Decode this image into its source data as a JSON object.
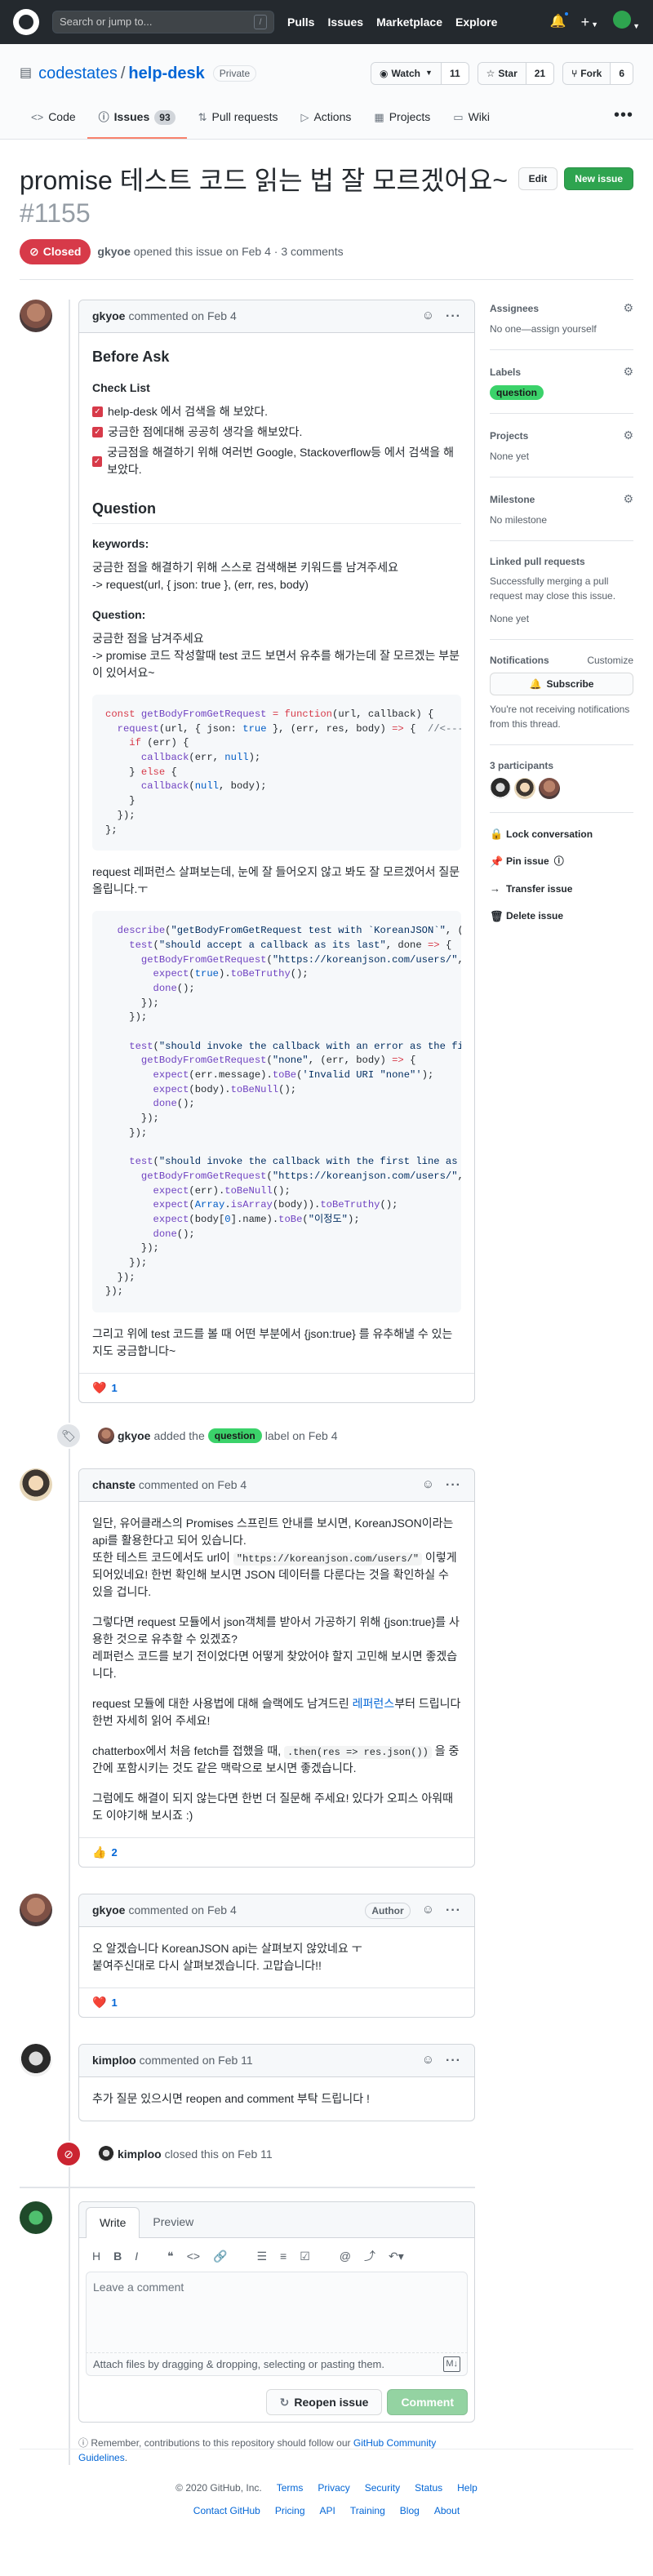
{
  "header": {
    "search_placeholder": "Search or jump to...",
    "search_key": "/",
    "nav": [
      "Pulls",
      "Issues",
      "Marketplace",
      "Explore"
    ]
  },
  "repo": {
    "owner": "codestates",
    "name": "help-desk",
    "visibility": "Private",
    "watch": {
      "label": "Watch",
      "count": "11"
    },
    "star": {
      "label": "Star",
      "count": "21"
    },
    "fork": {
      "label": "Fork",
      "count": "6"
    },
    "tabs": [
      {
        "label": "Code",
        "icon": "code-icon"
      },
      {
        "label": "Issues",
        "icon": "issue-icon",
        "count": "93"
      },
      {
        "label": "Pull requests",
        "icon": "pull-request-icon"
      },
      {
        "label": "Actions",
        "icon": "play-icon"
      },
      {
        "label": "Projects",
        "icon": "project-icon"
      },
      {
        "label": "Wiki",
        "icon": "book-icon"
      }
    ]
  },
  "issue": {
    "title": "promise 테스트 코드 읽는 법 잘 모르겠어요~",
    "number": "#1155",
    "state": "Closed",
    "author": "gkyoe",
    "opened_text": "opened this issue on Feb 4 · 3 comments",
    "edit_label": "Edit",
    "new_issue_label": "New issue"
  },
  "comments": [
    {
      "author": "gkyoe",
      "meta": "commented on Feb 4",
      "before_ask": "Before Ask",
      "checklist_title": "Check List",
      "checklist": [
        "help-desk 에서 검색을 해 보았다.",
        "궁금한 점에대해 공공히 생각을 해보았다.",
        "궁금점을 해결하기 위해 여러번 Google, Stackoverflow등 에서 검색을 해보았다."
      ],
      "question_heading": "Question",
      "keywords_label": "keywords:",
      "keywords_text1": "궁금한 점을 해결하기 위해 스스로 검색해본 키워드를 남겨주세요",
      "keywords_text2": "-> request(url, { json: true }, (err, res, body)",
      "question_label": "Question:",
      "question_text1": "궁금한 점을 남겨주세요",
      "question_text2": "-> promise 코드 작성할때 test 코드 보면서 유추를 해가는데 잘 모르겠는 부분이 있어서요~",
      "middle_text": "request 레퍼런스 살펴보는데, 눈에 잘 들어오지 않고 봐도 잘 모르겠어서 질문 올립니다.ㅜ",
      "closing_text": "그리고 위에 test 코드를 볼 때 어떤 부분에서 {json:true} 를 유추해낼 수 있는 지도 궁금합니다~",
      "reaction_emoji": "❤️",
      "reaction_count": "1"
    },
    {
      "author": "chanste",
      "meta": "commented on Feb 4",
      "p1": "일단, 유어클래스의 Promises 스프린트 안내를 보시면, KoreanJSON이라는 api를 활용한다고 되어 있습니다.",
      "p1b_pre": "또한 테스트 코드에서도 url이 ",
      "p1b_code": "\"https://koreanjson.com/users/\"",
      "p1b_post": " 이렇게 되어있네요! 한번 확인해 보시면 JSON 데이터를 다룬다는 것을 확인하실 수 있을 겁니다.",
      "p2": "그렇다면 request 모듈에서 json객체를 받아서 가공하기 위해 {json:true}를 사용한 것으로 유추할 수 있겠죠?",
      "p2b": "레퍼런스 코드를 보기 전이었다면 어떻게 찾았어야 할지 고민해 보시면 좋겠습니다.",
      "p3_pre": "request 모듈에 대한 사용법에 대해 슬랙에도 남겨드린 ",
      "p3_link": "레퍼런스",
      "p3_post": "부터 드립니다 한번 자세히 읽어 주세요!",
      "p4_pre": "chatterbox에서 처음 fetch를 접했을 때, ",
      "p4_code": ".then(res => res.json())",
      "p4_post": " 을 중간에 포함시키는 것도 같은 맥락으로 보시면 좋겠습니다.",
      "p5": "그럼에도 해결이 되지 않는다면 한번 더 질문해 주세요! 있다가 오피스 아워때도 이야기해 보시죠 :)",
      "reaction_emoji": "👍",
      "reaction_count": "2"
    },
    {
      "author": "gkyoe",
      "meta": "commented on Feb 4",
      "badge": "Author",
      "p1": "오 알겠습니다 KoreanJSON api는 살펴보지 않았네요 ㅜ",
      "p2": "붙여주신대로 다시 살펴보겠습니다. 고맙습니다!!",
      "reaction_emoji": "❤️",
      "reaction_count": "1"
    },
    {
      "author": "kimploo",
      "meta": "commented on Feb 11",
      "p1": "추가 질문 있으시면 reopen and comment 부탁 드립니다 !"
    }
  ],
  "events": {
    "label_event": {
      "actor": "gkyoe",
      "pre": "added the",
      "label": "question",
      "post": "label on Feb 4"
    },
    "closed_event": {
      "actor": "kimploo",
      "text": "closed this on Feb 11"
    }
  },
  "new_comment": {
    "write_tab": "Write",
    "preview_tab": "Preview",
    "placeholder": "Leave a comment",
    "attach_text": "Attach files by dragging & dropping, selecting or pasting them.",
    "reopen_label": "Reopen issue",
    "comment_label": "Comment",
    "note_pre": "Remember, contributions to this repository should follow our ",
    "note_link": "GitHub Community Guidelines",
    "note_post": "."
  },
  "sidebar": {
    "assignees_title": "Assignees",
    "assignees_text": "No one—assign yourself",
    "labels_title": "Labels",
    "label": "question",
    "projects_title": "Projects",
    "projects_text": "None yet",
    "milestone_title": "Milestone",
    "milestone_text": "No milestone",
    "linked_title": "Linked pull requests",
    "linked_desc": "Successfully merging a pull request may close this issue.",
    "linked_text": "None yet",
    "notifications_title": "Notifications",
    "customize_label": "Customize",
    "subscribe_label": "Subscribe",
    "notifications_desc": "You're not receiving notifications from this thread.",
    "participants_title": "3 participants",
    "lock_label": "Lock conversation",
    "pin_label": "Pin issue",
    "transfer_label": "Transfer issue",
    "delete_label": "Delete issue"
  },
  "footer": {
    "copyright": "© 2020 GitHub, Inc.",
    "row1": [
      "Terms",
      "Privacy",
      "Security",
      "Status",
      "Help"
    ],
    "row2": [
      "Contact GitHub",
      "Pricing",
      "API",
      "Training",
      "Blog",
      "About"
    ]
  }
}
